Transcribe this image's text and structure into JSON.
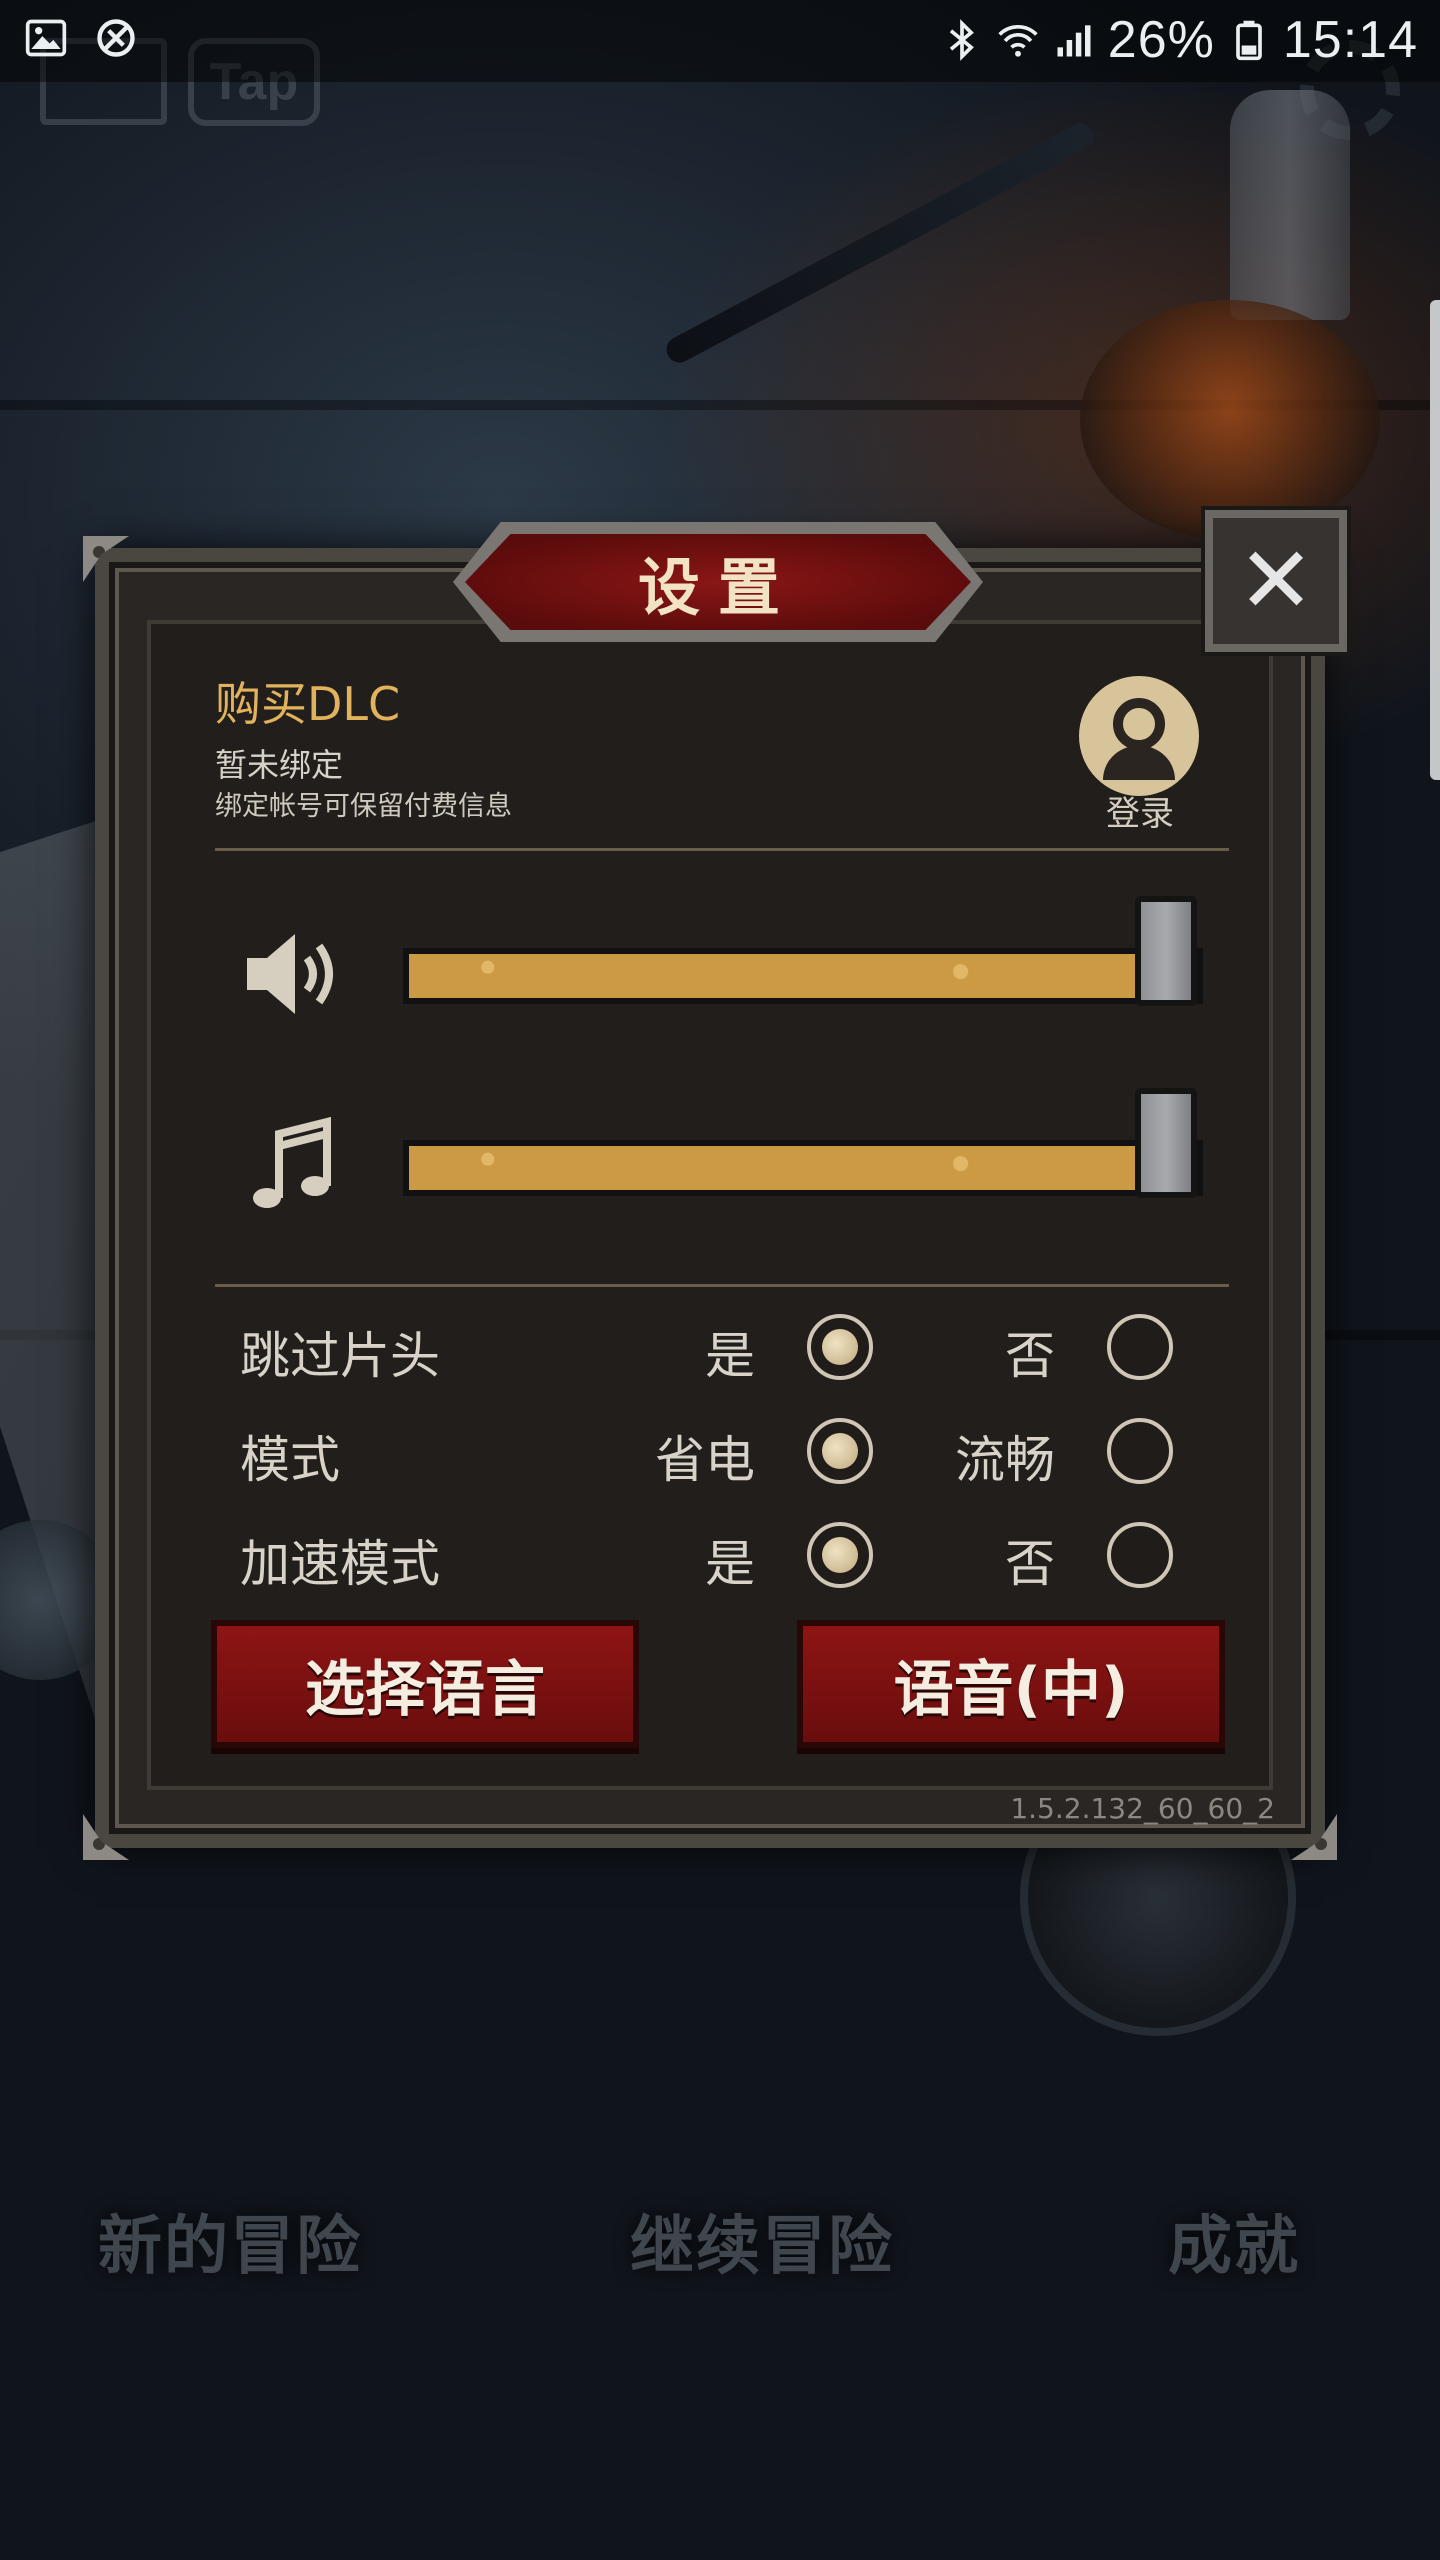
{
  "status_bar": {
    "battery": "26%",
    "time": "15:14"
  },
  "background": {
    "tap_logo": "Tap"
  },
  "dialog": {
    "title": "设置",
    "account": {
      "title": "购买DLC",
      "status": "暂未绑定",
      "description": "绑定帐号可保留付费信息",
      "login_label": "登录"
    },
    "sound_volume": 1.0,
    "music_volume": 1.0,
    "options": [
      {
        "label": "跳过片头",
        "choice_a": "是",
        "choice_b": "否",
        "selected": "a"
      },
      {
        "label": "模式",
        "choice_a": "省电",
        "choice_b": "流畅",
        "selected": "a"
      },
      {
        "label": "加速模式",
        "choice_a": "是",
        "choice_b": "否",
        "selected": "a"
      }
    ],
    "select_language_label": "选择语言",
    "voice_label": "语音(中)",
    "version": "1.5.2.132_60_60_2"
  },
  "bottom_menu": {
    "new_adventure": "新的冒险",
    "continue_adventure": "继续冒险",
    "achievements": "成就"
  },
  "colors": {
    "accent_gold": "#e2b35c",
    "button_red": "#8e1414",
    "slider_fill": "#cc9a45"
  }
}
